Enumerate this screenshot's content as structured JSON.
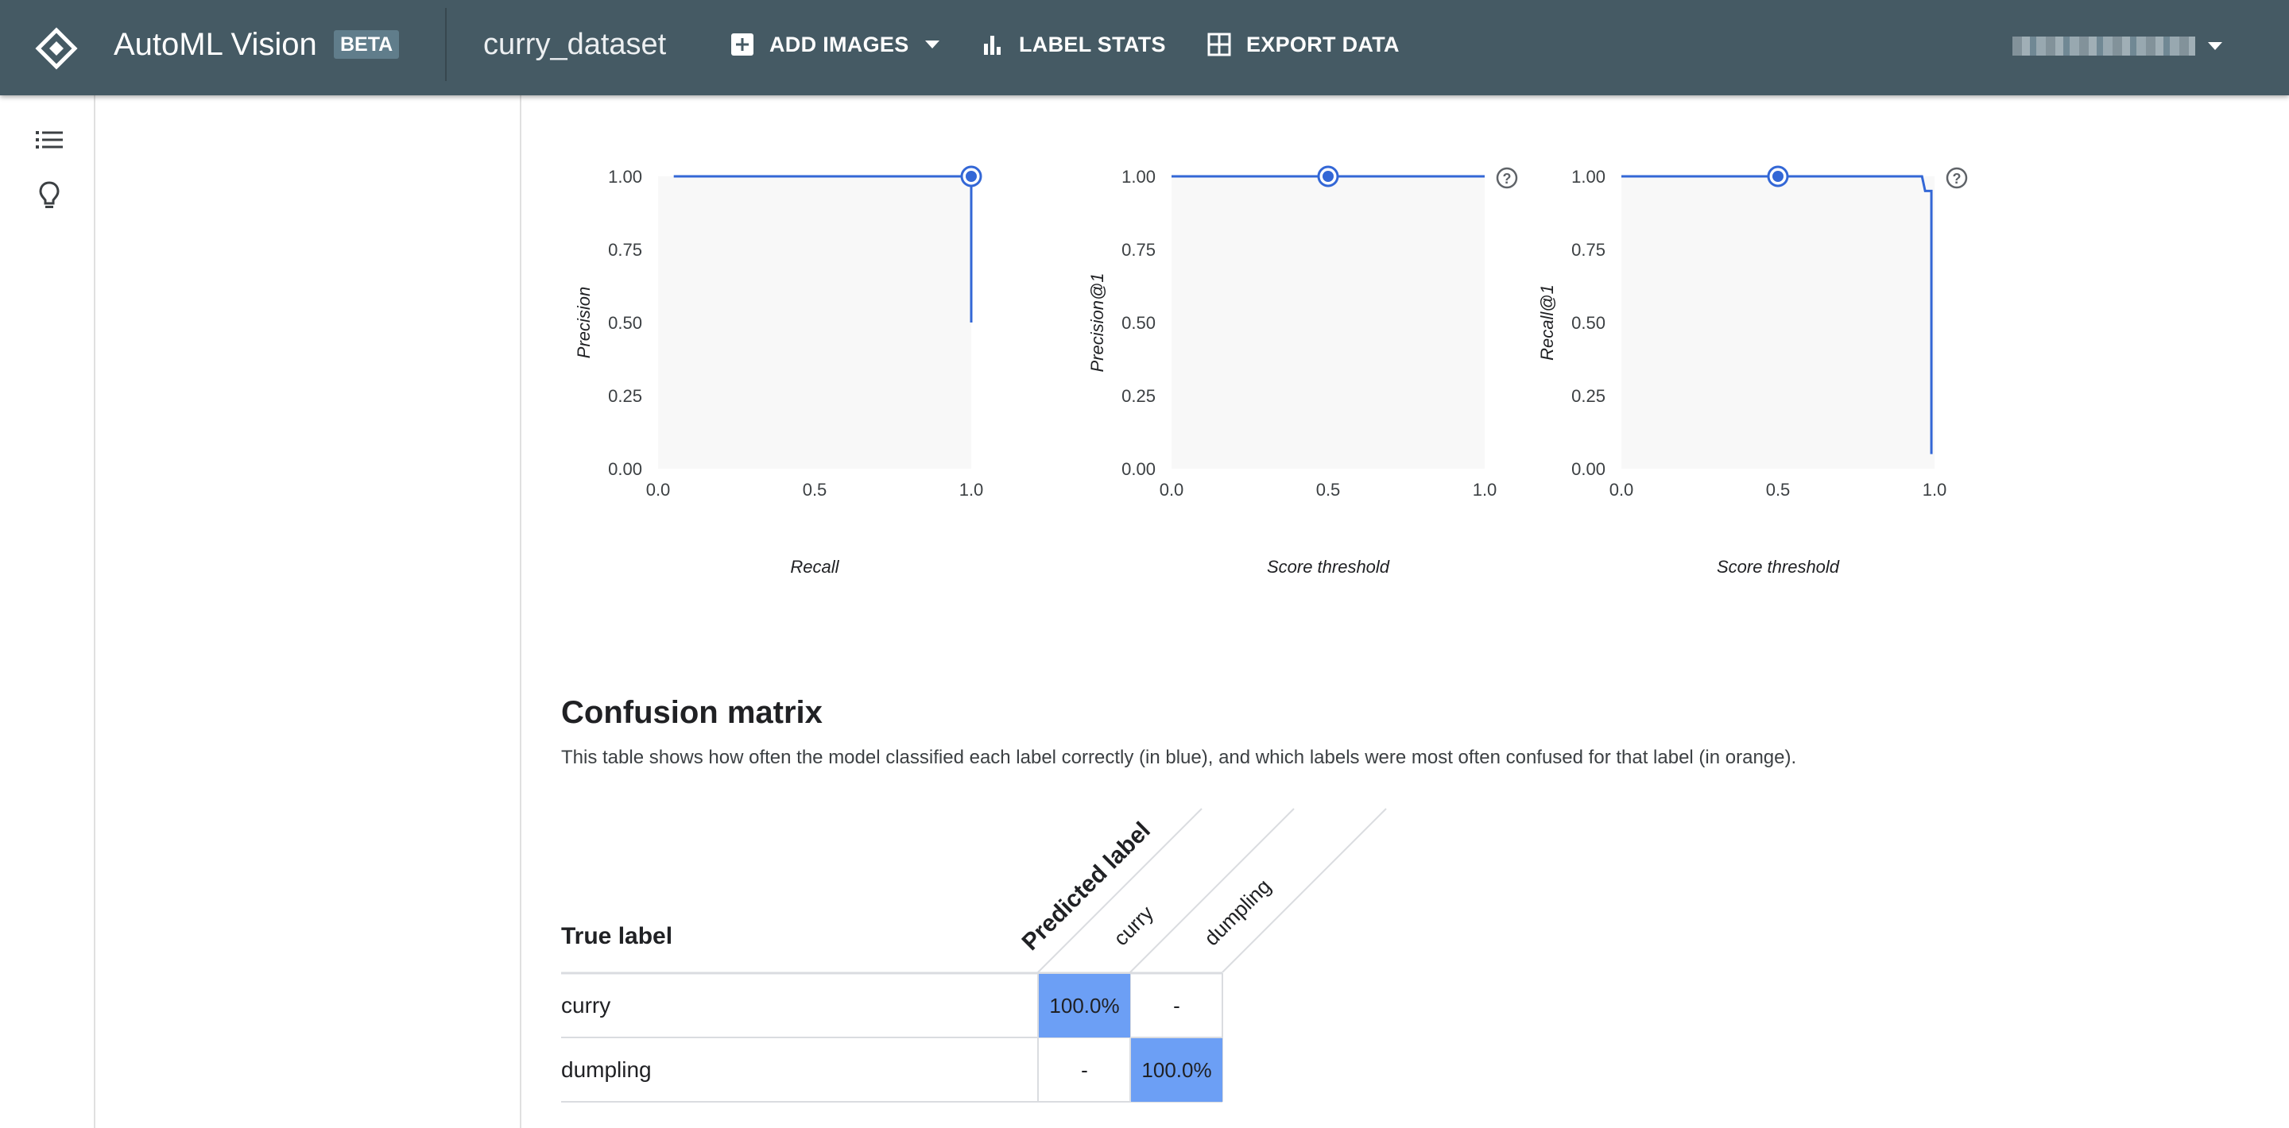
{
  "header": {
    "app_name": "AutoML Vision",
    "badge": "BETA",
    "dataset_name": "curry_dataset",
    "actions": {
      "add_images": "ADD IMAGES",
      "label_stats": "LABEL STATS",
      "export_data": "EXPORT DATA"
    }
  },
  "rail": {
    "icons": [
      "list-icon",
      "lightbulb-icon"
    ]
  },
  "charts": [
    {
      "type": "line",
      "ylabel": "Precision",
      "xlabel": "Recall",
      "xticks": [
        "0.0",
        "0.5",
        "1.0"
      ],
      "yticks": [
        "0.00",
        "0.25",
        "0.50",
        "0.75",
        "1.00"
      ],
      "help": false,
      "points": [
        [
          0.05,
          1.0
        ],
        [
          1.0,
          1.0
        ],
        [
          1.0,
          0.5
        ]
      ],
      "marker": [
        1.0,
        1.0
      ]
    },
    {
      "type": "line",
      "ylabel": "Precision@1",
      "xlabel": "Score threshold",
      "xticks": [
        "0.0",
        "0.5",
        "1.0"
      ],
      "yticks": [
        "0.00",
        "0.25",
        "0.50",
        "0.75",
        "1.00"
      ],
      "help": true,
      "points": [
        [
          0.0,
          1.0
        ],
        [
          1.0,
          1.0
        ]
      ],
      "marker": [
        0.5,
        1.0
      ]
    },
    {
      "type": "line",
      "ylabel": "Recall@1",
      "xlabel": "Score threshold",
      "xticks": [
        "0.0",
        "0.5",
        "1.0"
      ],
      "yticks": [
        "0.00",
        "0.25",
        "0.50",
        "0.75",
        "1.00"
      ],
      "help": true,
      "points": [
        [
          0.0,
          1.0
        ],
        [
          0.96,
          1.0
        ],
        [
          0.97,
          0.95
        ],
        [
          0.99,
          0.95
        ],
        [
          0.99,
          0.05
        ]
      ],
      "marker": [
        0.5,
        1.0
      ]
    }
  ],
  "confusion": {
    "title": "Confusion matrix",
    "description": "This table shows how often the model classified each label correctly (in blue), and which labels were most often confused for that label (in orange).",
    "true_label_header": "True label",
    "predicted_label_header": "Predicted label",
    "columns": [
      "curry",
      "dumpling"
    ],
    "rows": [
      {
        "label": "curry",
        "cells": [
          "100.0%",
          "-"
        ]
      },
      {
        "label": "dumpling",
        "cells": [
          "-",
          "100.0%"
        ]
      }
    ],
    "colors": {
      "correct": "#6c9ff5",
      "confused": "#f4a261"
    }
  },
  "colors": {
    "topbar": "#455a64",
    "line": "#3367d6",
    "plot_bg": "#f8f8f8"
  }
}
